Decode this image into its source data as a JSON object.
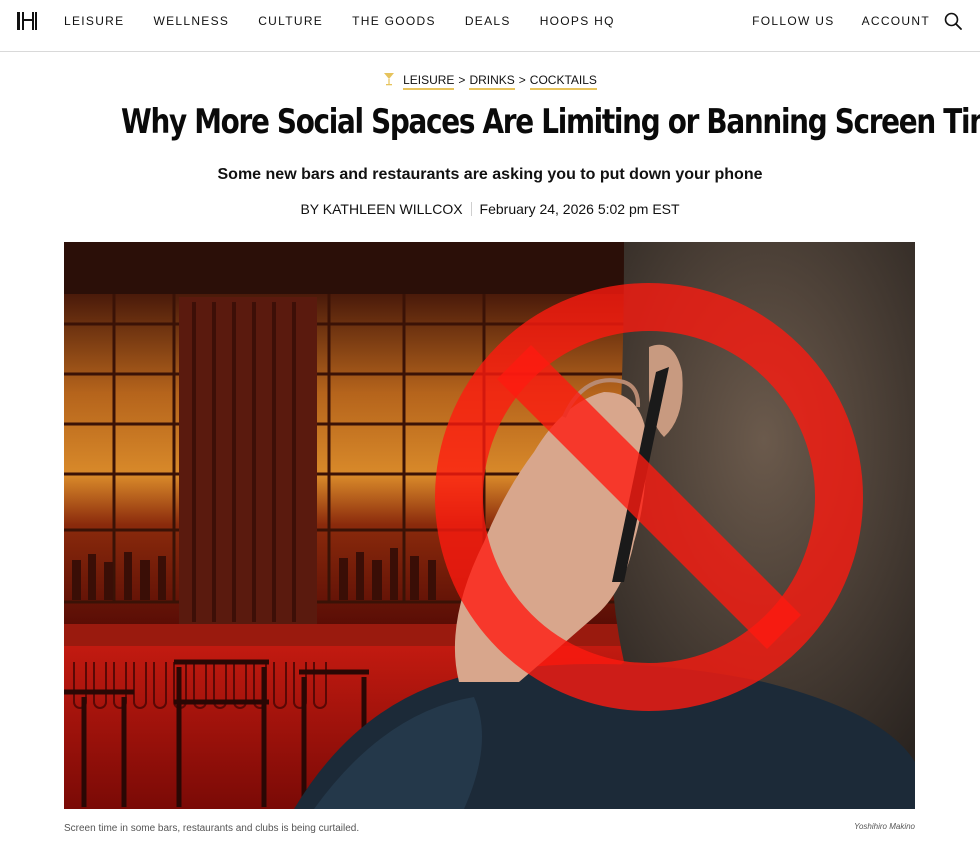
{
  "nav": {
    "left_items": [
      "LEISURE",
      "WELLNESS",
      "CULTURE",
      "THE GOODS",
      "DEALS",
      "HOOPS HQ"
    ],
    "right_items": [
      "FOLLOW US",
      "ACCOUNT"
    ]
  },
  "breadcrumb": {
    "items": [
      "LEISURE",
      "DRINKS",
      "COCKTAILS"
    ],
    "separator": ">"
  },
  "article": {
    "headline": "Why More Social Spaces Are Limiting or Banning Screen Time",
    "dek": "Some new bars and restaurants are asking you to put down your phone",
    "byline": "BY KATHLEEN WILLCOX",
    "date": "February 24, 2026 5:02 pm EST"
  },
  "hero": {
    "caption": "Screen time in some bars, restaurants and clubs is being curtailed.",
    "credit": "Yoshihiro Makino"
  },
  "colors": {
    "accent_underline": "#e6c35c",
    "ban_red": "#ff1a10"
  }
}
